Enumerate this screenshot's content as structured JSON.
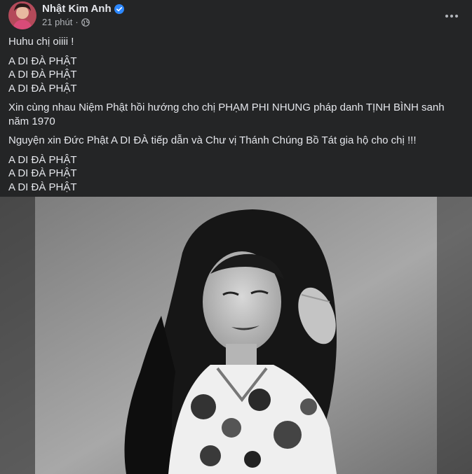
{
  "post": {
    "author": {
      "name": "Nhật Kim Anh",
      "verified": true
    },
    "timestamp": "21 phút",
    "separator": "·",
    "privacy_icon": "globe-icon",
    "more_icon": "more-horizontal-icon",
    "paragraphs": [
      [
        "Huhu chị oiiii !"
      ],
      [
        "A DI ĐÀ PHẬT",
        "A DI ĐÀ PHẬT",
        "A DI ĐÀ PHẬT"
      ],
      [
        "Xin cùng nhau Niệm Phật hồi hướng cho chị PHẠM PHI NHUNG pháp danh TỊNH BÌNH sanh năm 1970"
      ],
      [
        "Nguyện xin Đức Phật A DI ĐÀ tiếp dẫn và Chư vị Thánh Chúng Bồ Tát gia hộ cho chị !!!"
      ],
      [
        "A DI ĐÀ PHẬT",
        "A DI ĐÀ PHẬT",
        "A DI ĐÀ PHẬT"
      ]
    ],
    "photo": {
      "style": "black-and-white portrait"
    }
  },
  "colors": {
    "background": "#242526",
    "text_primary": "#e4e6eb",
    "text_secondary": "#b0b3b8",
    "verified": "#2d88ff"
  }
}
